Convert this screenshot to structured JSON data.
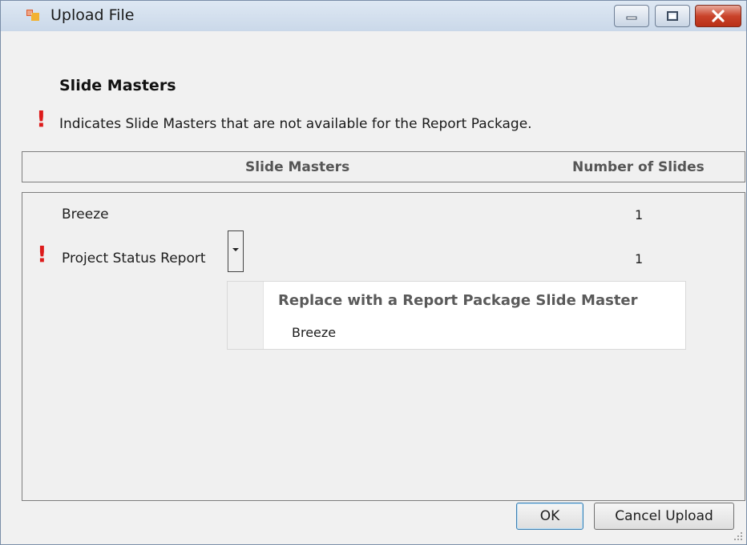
{
  "window": {
    "title": "Upload File",
    "accent": "#dd1b1b"
  },
  "header": {
    "title": "Slide Masters",
    "info": "Indicates Slide Masters that are not available for the Report Package."
  },
  "grid": {
    "columns": [
      "Slide Masters",
      "Number of Slides"
    ],
    "rows": [
      {
        "name": "Breeze",
        "count": "1",
        "warning": false
      },
      {
        "name": "Project Status Report",
        "count": "1",
        "warning": true
      }
    ]
  },
  "menu": {
    "header": "Replace with a Report Package Slide Master",
    "items": [
      "Breeze"
    ]
  },
  "buttons": {
    "ok": "OK",
    "cancel": "Cancel Upload"
  }
}
